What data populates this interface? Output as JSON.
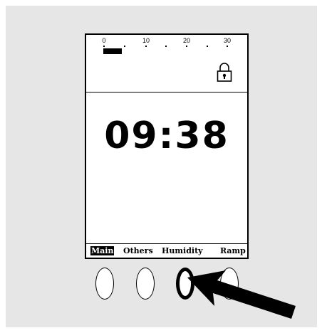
{
  "scale": {
    "labels": [
      "0",
      "10",
      "20",
      "30"
    ],
    "level": 4
  },
  "display": {
    "time": "09:38",
    "locked": true
  },
  "tabs": [
    {
      "label": "Main",
      "active": true
    },
    {
      "label": "Others",
      "active": false
    },
    {
      "label": "Humidity",
      "active": false
    },
    {
      "label": "Ramp",
      "active": false
    }
  ],
  "buttons": [
    {
      "id": "button-1",
      "pressed": false
    },
    {
      "id": "button-2",
      "pressed": false
    },
    {
      "id": "button-3",
      "pressed": true
    },
    {
      "id": "button-4",
      "pressed": false
    }
  ],
  "icons": {
    "lock": "lock-icon",
    "pointer": "arrow-icon"
  },
  "colors": {
    "panel": "#e6e6e6",
    "screen": "#ffffff",
    "ink": "#000000"
  }
}
